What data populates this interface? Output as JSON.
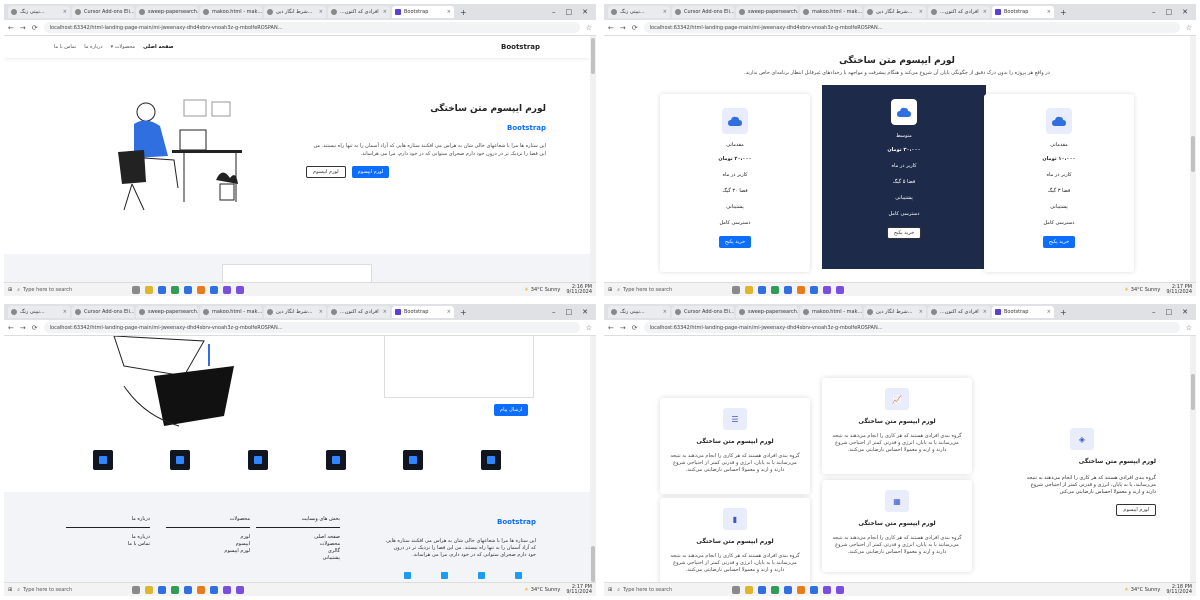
{
  "browser": {
    "tabs": [
      "تیپتی زنگ...",
      "Cursor Add-ons Eli...",
      "sweep-papersearch...",
      "makoo.html - mak...",
      "شرط انگار دین...",
      "...افرادی که اکنون",
      "Bootstrap"
    ],
    "active_tab": "Bootstrap",
    "url": "localhost:63342/html-landing-page-main/mi-jweenaxy-dhd4sbrv-vnoah3z-g-mbolfeROSPAN..."
  },
  "taskbar": {
    "search_placeholder": "Type here to search",
    "weather": "34°C Sunny",
    "times": [
      "2:16 PM",
      "2:17 PM",
      "2:17 PM",
      "2:18 PM"
    ],
    "date": "9/11/2024"
  },
  "landing": {
    "brand": "Bootstrap",
    "nav": [
      "صفحه اصلی",
      "محصولات",
      "درباره ما",
      "تماس با ما"
    ],
    "hero_title": "لورم ایپسوم متن ساختگی",
    "hero_subtitle": "Bootstrap",
    "hero_text": "این ستاره ها مرا با شعاعهای خالی شان به هراس می افکنند ستاره هایی که آزاد آسمان را به تنها راه نیستند. من این فضا را نزدیک تر در درون خود دارم صحرای ستوانی که در خود دارم، مرا می هراساند.",
    "btn_primary": "لورم ایپسوم",
    "btn_secondary": "لورم ایپسوم"
  },
  "pricing": {
    "title": "لورم ایپسوم متن ساختگی",
    "subtitle": "در واقع هر پروژه را بدون درک دقیق از چگونگی پایان آن شروع می‌کند و هنگام پیشرفت و مواجهه با رخدادهای غیرقابل انتظار برنامه‌ای خاص ندارند.",
    "plans": [
      {
        "name": "مقدماتی",
        "price": "۲۰،۰۰۰ تومان",
        "features": [
          "کاربر در ماه",
          "فضا ۳۰ گیگ",
          "پشتیبانی",
          "دسترسی کامل"
        ],
        "button": "خرید پکیج"
      },
      {
        "name": "متوسط",
        "price": "۳۰،۰۰۰ تومان",
        "features": [
          "کاربر در ماه",
          "فضا ۵ گیگ",
          "پشتیبانی",
          "دسترسی کامل"
        ],
        "button": "خرید پکیج"
      },
      {
        "name": "مقدماتی",
        "price": "۱۰،۰۰۰ تومان",
        "features": [
          "کاربر در ماه",
          "فضا ۳ گیگ",
          "پشتیبانی",
          "دسترسی کامل"
        ],
        "button": "خرید پکیج"
      }
    ]
  },
  "contact": {
    "send_button": "ارسال پیام"
  },
  "footer": {
    "brand": "Bootstrap",
    "about": "این ستاره ها مرا با شعاعهای خالی شان به هراس می افکنند ستاره هایی که آزاد آسمان را به تنها راه نیستند. من این فضا را نزدیک تر در درون خود دارم صحرای ستوانی که در خود دارم، مرا می هراساند.",
    "columns": [
      {
        "title": "بخش های وبسایت",
        "links": [
          "صفحه اصلی",
          "محصولات",
          "گالری",
          "پشتیبانی"
        ]
      },
      {
        "title": "محصولات",
        "links": [
          "لورم",
          "ایپسوم",
          "لورم ایپسوم"
        ]
      },
      {
        "title": "درباره ما",
        "links": [
          "درباره ما",
          "تماس با ما"
        ]
      }
    ]
  },
  "features": {
    "card_title": "لورم ایپسوم متن ساختگی",
    "card_text": "گروه بندی افرادی هستند که هر کاری را انجام می‌دهند به نتیجه می‌رسانند یا به پایان، انرژی و قدرتی کمتر از احتیاجی شروع دارند و ارند و معمولا احساس نارضایتی می‌کنند.",
    "side_title": "لورم ایپسوم متن ساختگی",
    "side_text": "گروه بندی افرادی هستند که هر کاری را انجام می‌دهند به نتیجه می‌رسانند، یا به پایان، انرژی و قدرتی کمتر از احتیاجی شروع دارند و ارند و معمولا احساس نارضایتی می‌کنن",
    "side_button": "لورم ایپسوم"
  }
}
